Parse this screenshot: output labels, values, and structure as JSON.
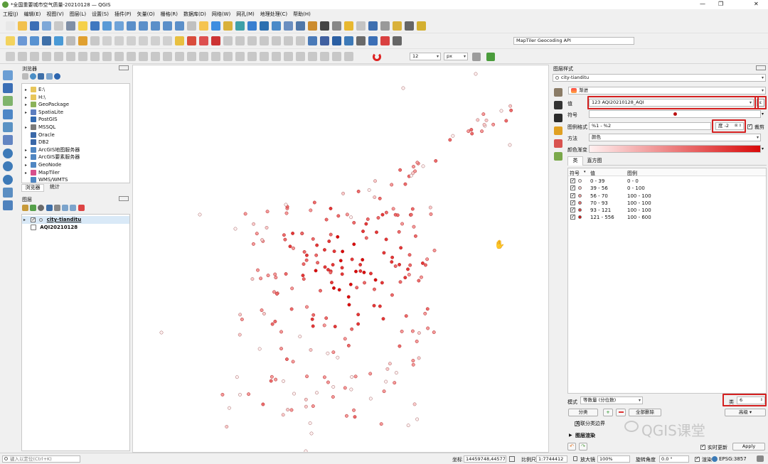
{
  "window": {
    "title": "*全国重要城市空气质量-20210128 — QGIS",
    "controls": {
      "minimize": "—",
      "restore": "❐",
      "close": "✕"
    }
  },
  "menu": [
    "工程(J)",
    "编辑(E)",
    "视图(V)",
    "图层(L)",
    "设置(S)",
    "插件(P)",
    "矢量(O)",
    "栅格(R)",
    "数据库(D)",
    "网络(W)",
    "网孔(M)",
    "地理处理(C)",
    "帮助(H)"
  ],
  "toolbar": {
    "geocoding_placeholder": "MapTiler Geocoding API",
    "font_size_value": "12",
    "font_unit": "px"
  },
  "browser_panel": {
    "title": "浏览器",
    "items": [
      {
        "label": "E:\\",
        "expand": true,
        "icon": "folder-icon"
      },
      {
        "label": "H:\\",
        "expand": true,
        "icon": "folder-icon"
      },
      {
        "label": "GeoPackage",
        "expand": true,
        "icon": "geopackage-icon"
      },
      {
        "label": "SpatiaLite",
        "expand": true,
        "icon": "spatialite-icon"
      },
      {
        "label": "PostGIS",
        "expand": false,
        "icon": "postgis-icon"
      },
      {
        "label": "MSSQL",
        "expand": true,
        "icon": "mssql-icon"
      },
      {
        "label": "Oracle",
        "expand": false,
        "icon": "oracle-icon"
      },
      {
        "label": "DB2",
        "expand": false,
        "icon": "db2-icon"
      },
      {
        "label": "ArcGIS地图服务器",
        "expand": true,
        "icon": "arcgis-map-icon"
      },
      {
        "label": "ArcGIS要素服务器",
        "expand": true,
        "icon": "arcgis-feature-icon"
      },
      {
        "label": "GeoNode",
        "expand": true,
        "icon": "geonode-icon"
      },
      {
        "label": "MapTiler",
        "expand": true,
        "icon": "maptiler-icon"
      },
      {
        "label": "WMS/WMTS",
        "expand": false,
        "icon": "wms-icon"
      }
    ],
    "tabs": [
      "浏览器",
      "统计"
    ]
  },
  "layers_panel": {
    "title": "图层",
    "layers": [
      {
        "label": "city-tianditu",
        "checked": true,
        "active": true
      },
      {
        "label": "AQI20210128",
        "checked": false,
        "active": false
      }
    ]
  },
  "style_panel": {
    "title": "图层样式",
    "layer": "city-tianditu",
    "renderer": "渐进",
    "value_label": "值",
    "value_field": "123 AQI20210128_AQI",
    "symbol_label": "符号",
    "legend_format_label": "图例格式",
    "legend_format_value": "%1 - %2",
    "precision_label": "度",
    "precision_value": "-2",
    "trim_label": "裁剪",
    "method_label": "方法",
    "method_value": "颜色",
    "color_ramp_label": "颜色渐变",
    "tabs": [
      "类",
      "直方图"
    ],
    "columns": [
      "符号",
      "值",
      "图例"
    ],
    "classes": [
      {
        "value": "0 - 39",
        "legend": "0 - 0",
        "color": "#fff1f1"
      },
      {
        "value": "39 - 56",
        "legend": "0 - 100",
        "color": "#fbc9c9"
      },
      {
        "value": "56 - 70",
        "legend": "100 - 100",
        "color": "#f49b9b"
      },
      {
        "value": "70 - 93",
        "legend": "100 - 100",
        "color": "#ec6c6c"
      },
      {
        "value": "93 - 121",
        "legend": "100 - 100",
        "color": "#e33838"
      },
      {
        "value": "121 - 556",
        "legend": "100 - 600",
        "color": "#d90a0a"
      }
    ],
    "mode_label": "模式",
    "mode_value": "等数量 (分位数)",
    "classes_label": "类",
    "classes_value": "6",
    "classify_button": "分类",
    "delete_all_button": "全部删除",
    "advanced_button": "高级",
    "link_boundaries_label": "关联分类边界",
    "layer_rendering_label": "图层渲染",
    "live_update_label": "实时更新",
    "apply_button": "Apply"
  },
  "status_bar": {
    "locator_placeholder": "键入以定位(Ctrl+K)",
    "coord_label": "坐标",
    "coord_value": "14459748,4457723",
    "scale_label": "比例尺",
    "scale_value": "1:7744412",
    "magnifier_label": "放大镜",
    "magnifier_value": "100%",
    "rotation_label": "旋转角度",
    "rotation_value": "0.0 °",
    "render_label": "渲染",
    "crs_value": "EPSG:3857"
  },
  "watermark": "QGIS课堂",
  "colors": {
    "selection_red": "#d42020",
    "ramp_start": "#fff0f0",
    "ramp_end": "#d90a0a"
  }
}
